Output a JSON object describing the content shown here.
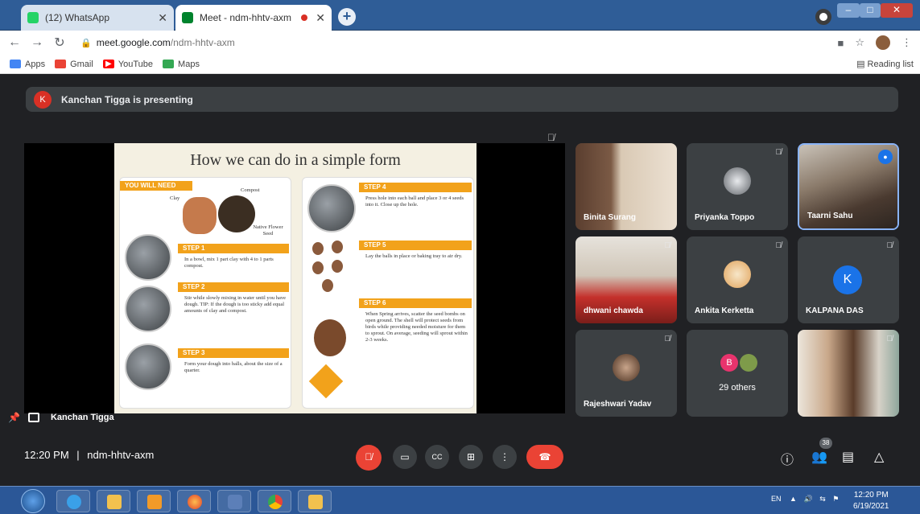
{
  "browser": {
    "tabs": [
      {
        "title": "(12) WhatsApp",
        "favicon_color": "#25d366"
      },
      {
        "title": "Meet - ndm-hhtv-axm",
        "favicon_color": "#00832d"
      }
    ],
    "url_host": "meet.google.com",
    "url_path": "/ndm-hhtv-axm",
    "bookmarks": [
      {
        "label": "Apps",
        "color": "#4285f4"
      },
      {
        "label": "Gmail",
        "color": "#ea4335"
      },
      {
        "label": "YouTube",
        "color": "#ff0000"
      },
      {
        "label": "Maps",
        "color": "#34a853"
      }
    ],
    "reading_list": "Reading list"
  },
  "meet": {
    "banner": "Kanchan Tigga is presenting",
    "presenter_initial": "K",
    "presenter_name": "Kanchan Tigga",
    "slide": {
      "title": "How we can do in a simple form",
      "you_will_need": "YOU WILL NEED",
      "ingredients": [
        "Clay",
        "Compost",
        "Native Flower Seed"
      ],
      "steps": [
        {
          "label": "STEP 1",
          "text": "In a bowl, mix 1 part clay with 4 to 1 parts compost."
        },
        {
          "label": "STEP 2",
          "text": "Stir while slowly mixing in water until you have dough. TIP: If the dough is too sticky add equal amounts of clay and compost."
        },
        {
          "label": "STEP 3",
          "text": "Form your dough into balls, about the size of a quarter."
        },
        {
          "label": "STEP 4",
          "text": "Press hole into each ball and place 3 or 4 seeds into it. Close up the hole."
        },
        {
          "label": "STEP 5",
          "text": "Lay the balls in place or baking tray to air dry."
        },
        {
          "label": "STEP 6",
          "text": "When Spring arrives, scatter the seed bombs on open ground. The shell will protect seeds from birds while providing needed moisture for them to sprout. On average, seeding will sprout within 2-3 weeks."
        }
      ]
    },
    "participants": [
      {
        "name": "Binita Surang"
      },
      {
        "name": "Priyanka Toppo"
      },
      {
        "name": "Taarni Sahu"
      },
      {
        "name": "dhwani chawda"
      },
      {
        "name": "Ankita Kerketta"
      },
      {
        "name": "KALPANA DAS",
        "initial": "K"
      },
      {
        "name": "Rajeshwari Yadav"
      },
      {
        "name": "29 others",
        "initial": "B"
      }
    ],
    "time": "12:20 PM",
    "separator": "|",
    "meeting_code": "ndm-hhtv-axm",
    "people_count": "38",
    "controls": {
      "cc": "CC"
    }
  },
  "taskbar": {
    "lang": "EN",
    "time": "12:20 PM",
    "date": "6/19/2021"
  },
  "colors": {
    "accent_red": "#ea4335",
    "accent_blue": "#1a73e8",
    "slide_orange": "#f2a21b"
  }
}
